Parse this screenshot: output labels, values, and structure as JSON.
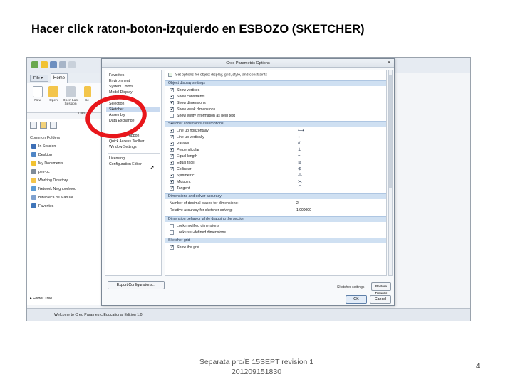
{
  "slide": {
    "title": "Hacer click raton-boton-izquierdo en ESBOZO (SKETCHER)",
    "footer_line1": "Separata pro/E 15SEPT revision 1",
    "footer_line2": "201209151830",
    "page_number": "4"
  },
  "ribbon": {
    "file_tab": "File ▾",
    "home_tab": "Home",
    "buttons": [
      {
        "label": "New"
      },
      {
        "label": "Open"
      },
      {
        "label": "Open Last Session"
      },
      {
        "label": "Se"
      }
    ],
    "group_label": "Data"
  },
  "navigator": {
    "header": "Common Folders",
    "items": [
      {
        "label": "In Session"
      },
      {
        "label": "Desktop"
      },
      {
        "label": "My Documents"
      },
      {
        "label": "pes-pc"
      },
      {
        "label": "Working Directory"
      },
      {
        "label": "Network Neighborhood"
      },
      {
        "label": "Biblioteca de Manual"
      },
      {
        "label": "Favorites"
      }
    ],
    "folder_tree": "▸ Folder Tree"
  },
  "status_bar": {
    "message": "Welcome to Creo Parametric Educational Edition 1.0"
  },
  "dialog": {
    "title": "Creo Parametric Options",
    "close": "✕",
    "categories": [
      {
        "label": "Favorites"
      },
      {
        "label": "Environment"
      },
      {
        "label": "System Colors"
      },
      {
        "label": "Model Display"
      },
      {
        "label": "Entity Display"
      },
      {
        "label": "Selection"
      },
      {
        "label": "Sketcher",
        "selected": true
      },
      {
        "label": "Assembly"
      },
      {
        "label": "Data Exchange"
      },
      {
        "label": "Customize Ribbon"
      },
      {
        "label": "Quick Access Toolbar"
      },
      {
        "label": "Window Settings"
      },
      {
        "label": "Licensing"
      },
      {
        "label": "Configuration Editor"
      }
    ],
    "export_label": "Export Configurations...",
    "top_option": "Set options for object display, grid, style, and constraints",
    "sections": {
      "display": "Object display settings",
      "constraints": "Sketcher constraints assumptions",
      "accuracy": "Dimensions and solver accuracy",
      "drag": "Dimension behavior while dragging the section",
      "grid": "Sketcher grid"
    },
    "display_options": [
      {
        "label": "Show vertices",
        "checked": true
      },
      {
        "label": "Show constraints",
        "checked": true
      },
      {
        "label": "Show dimensions",
        "checked": true
      },
      {
        "label": "Show weak dimensions",
        "checked": true
      },
      {
        "label": "Show entity information as help text",
        "checked": false
      }
    ],
    "constraint_options": [
      {
        "label": "Line up horizontally",
        "glyph": "⟷",
        "checked": true
      },
      {
        "label": "Line up vertically",
        "glyph": "↕",
        "checked": true
      },
      {
        "label": "Parallel",
        "glyph": "//",
        "checked": true
      },
      {
        "label": "Perpendicular",
        "glyph": "⊥",
        "checked": true
      },
      {
        "label": "Equal length",
        "glyph": "=",
        "checked": true
      },
      {
        "label": "Equal radii",
        "glyph": "≅",
        "checked": true
      },
      {
        "label": "Collinear",
        "glyph": "⊕",
        "checked": true
      },
      {
        "label": "Symmetric",
        "glyph": "⁂",
        "checked": true
      },
      {
        "label": "Midpoint",
        "glyph": "⋋",
        "checked": true
      },
      {
        "label": "Tangent",
        "glyph": "⌒",
        "checked": true
      }
    ],
    "accuracy_fields": [
      {
        "label": "Number of decimal places for dimensions:",
        "value": "2"
      },
      {
        "label": "Relative accuracy for sketcher solving:",
        "value": "1.000000"
      }
    ],
    "drag_options": [
      {
        "label": "Lock modified dimensions",
        "checked": false
      },
      {
        "label": "Lock user-defined dimensions",
        "checked": false
      }
    ],
    "grid_option": {
      "label": "Show the grid",
      "checked": true
    },
    "sketcher_settings_label": "Sketcher settings",
    "restore_label": "Restore Defaults",
    "ok_label": "OK",
    "cancel_label": "Cancel"
  },
  "colors": {
    "highlight_ellipse": "#e8161b",
    "section_header": "#cfe0f2",
    "selected_row": "#c9daf0"
  }
}
